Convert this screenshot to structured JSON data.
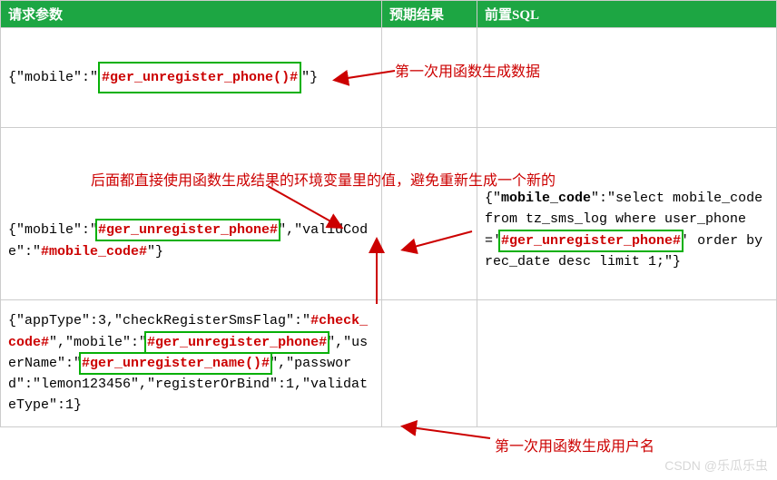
{
  "headers": {
    "col1": "请求参数",
    "col2": "预期结果",
    "col3": "前置SQL"
  },
  "row1": {
    "pre": "{\"mobile\":\"",
    "hl1": "#ger_unregister_phone()#",
    "post": "\"}"
  },
  "row2": {
    "pre": "{\"mobile\":\"",
    "hl1": "#ger_unregister_phone#",
    "mid1": "\",\"validCode\":\"",
    "hl2": "#mobile_code#",
    "post": "\"}",
    "sql_pre": "{\"",
    "sql_key": "mobile_code",
    "sql_mid1": "\":\"select mobile_code  from tz_sms_log where user_phone='",
    "sql_hl": "#ger_unregister_phone#",
    "sql_mid2": "'  order by rec_date desc limit 1;\"}"
  },
  "row3": {
    "p1": "{\"appType\":3,\"checkRegisterSmsFlag\":\"",
    "hl1": "#check_code#",
    "p2": "\",\"mobile\":\"",
    "hl2": "#ger_unregister_phone#",
    "p3": "\",\"userName\":\"",
    "hl3": "#ger_unregister_name()#",
    "p4": "\",\"password\":\"lemon123456\",\"registerOrBind\":1,\"validateType\":1}"
  },
  "annotations": {
    "a1": "第一次用函数生成数据",
    "a2": "后面都直接使用函数生成结果的环境变量里的值，避免重新生成一个新的",
    "a3": "第一次用函数生成用户名"
  },
  "watermark": "CSDN @乐瓜乐虫"
}
